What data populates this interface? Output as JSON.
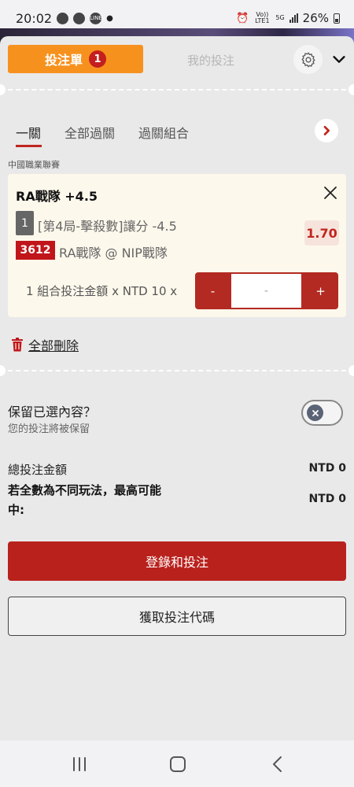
{
  "status_bar": {
    "time": "20:02",
    "battery": "26%",
    "network": "5G",
    "volte": "Vo)) LTE1"
  },
  "header": {
    "tab_bets_label": "投注單",
    "tab_bets_count": "1",
    "tab_mine_label": "我的投注"
  },
  "subtabs": {
    "single": "一關",
    "all_parlay": "全部過關",
    "parlay_combo": "過關組合"
  },
  "league": "中國職業聯賽",
  "bet": {
    "title": "RA戰隊 +4.5",
    "index": "1",
    "market": "[第4局-擊殺數]讓分 -4.5",
    "odds": "1.70",
    "match_id": "3612",
    "match_name": "RA戰隊 @ NIP戰隊",
    "combo_label": "1 組合投注金額 x NTD 10 x",
    "stepper_minus": "-",
    "stepper_value": "-",
    "stepper_plus": "+"
  },
  "delete_all_label": "全部刪除",
  "keep": {
    "title": "保留已選內容？",
    "subtitle": "您的投注將被保留",
    "toggle_on": false
  },
  "totals": {
    "total_label": "總投注金額",
    "total_value": "NTD 0",
    "max_label": "若全數為不同玩法，最高可能中:",
    "max_value": "NTD 0"
  },
  "buttons": {
    "login_bet": "登錄和投注",
    "get_code": "獲取投注代碼"
  },
  "colors": {
    "accent_orange": "#f7911e",
    "primary_red": "#b9211c",
    "badge_red": "#c41e1e"
  }
}
